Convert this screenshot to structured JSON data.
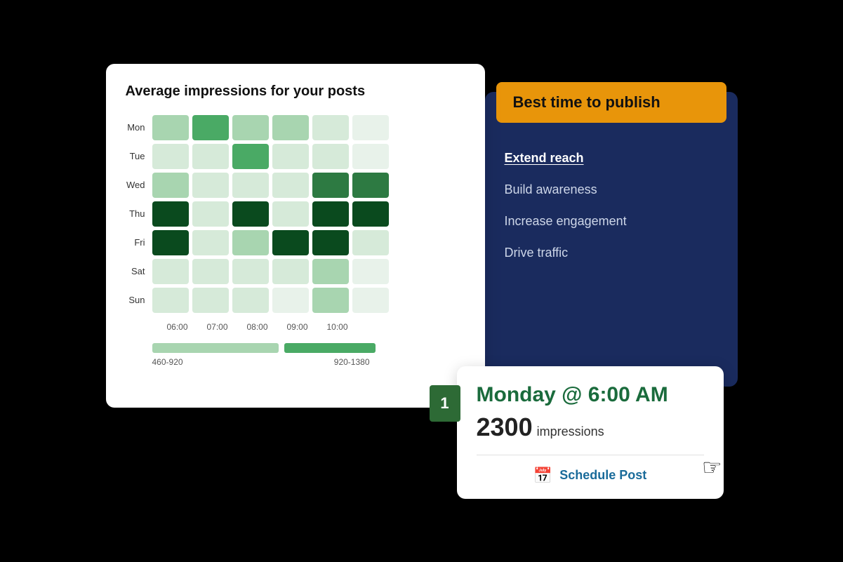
{
  "heatmap": {
    "title_prefix": "Average impressions",
    "title_suffix": " for your posts",
    "days": [
      "Mon",
      "Tue",
      "Wed",
      "Thu",
      "Fri",
      "Sat",
      "Sun"
    ],
    "times": [
      "06:00",
      "07:00",
      "08:00",
      "09:00",
      "10:00"
    ],
    "cells": {
      "Mon": [
        "medium",
        "dark",
        "medium",
        "medium",
        "light",
        "light"
      ],
      "Tue": [
        "light",
        "light",
        "medium",
        "light",
        "light",
        "light"
      ],
      "Wed": [
        "medium",
        "light",
        "light",
        "light",
        "dark",
        "dark"
      ],
      "Thu": [
        "darkest",
        "light",
        "darkest",
        "light",
        "darkest",
        "darkest"
      ],
      "Fri": [
        "darkest",
        "light",
        "medium",
        "darkest",
        "darkest",
        "light"
      ],
      "Sat": [
        "light",
        "light",
        "light",
        "light",
        "medium",
        "light"
      ],
      "Sun": [
        "light",
        "light",
        "light",
        "light",
        "medium",
        "light"
      ]
    },
    "legend": {
      "bar1_label": "460-920",
      "bar2_label": "920-1380"
    }
  },
  "sidebar": {
    "banner_text": "Best time to publish",
    "menu_items": [
      {
        "label": "Extend reach",
        "active": true
      },
      {
        "label": "Build awareness",
        "active": false
      },
      {
        "label": "Increase engagement",
        "active": false
      },
      {
        "label": "Drive traffic",
        "active": false
      }
    ]
  },
  "result": {
    "day_time": "Monday  @ 6:00 AM",
    "impressions_number": "2300",
    "impressions_label": "impressions",
    "schedule_label": "Schedule Post",
    "rank": "1"
  }
}
